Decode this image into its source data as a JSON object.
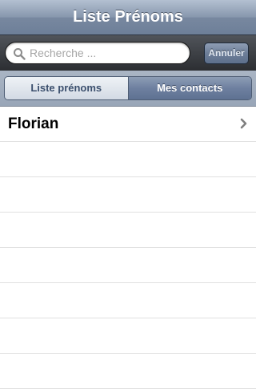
{
  "navbar": {
    "title": "Liste Prénoms"
  },
  "search": {
    "placeholder": "Recherche ...",
    "value": "",
    "cancel_label": "Annuler"
  },
  "scope": {
    "tabs": [
      {
        "label": "Liste prénoms",
        "selected": true
      },
      {
        "label": "Mes contacts",
        "selected": false
      }
    ]
  },
  "list": {
    "rows": [
      "Florian",
      "",
      "",
      "",
      "",
      "",
      "",
      ""
    ]
  },
  "colors": {
    "navbar": "#8797ad",
    "search_bar": "#2c2e32",
    "scope_bar": "#98a5b7",
    "separator": "#e0e0e0"
  },
  "icons": {
    "search": "search-icon",
    "disclosure": "chevron-right-icon"
  }
}
